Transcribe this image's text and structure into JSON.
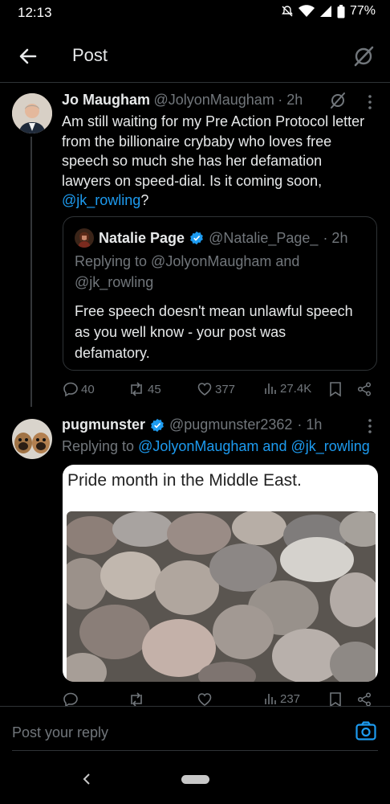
{
  "status_bar": {
    "time": "12:13",
    "battery": "77%"
  },
  "header": {
    "title": "Post"
  },
  "main_tweet": {
    "name": "Jo Maugham",
    "handle": "@JolyonMaugham",
    "time": "· 2h",
    "text_before": "Am still waiting for my Pre Action Protocol letter from the billionaire crybaby who loves free speech so much she has her defamation lawyers on speed-dial. Is it coming soon, ",
    "mention": "@jk_rowling",
    "text_after": "?",
    "quote": {
      "name": "Natalie Page",
      "handle": "@Natalie_Page_",
      "time": "· 2h",
      "reply_to": "Replying to @JolyonMaugham and @jk_rowling",
      "text": "Free speech doesn't mean unlawful speech as you well know - your post was defamatory."
    },
    "stats": {
      "replies": "40",
      "reposts": "45",
      "likes": "377",
      "views": "27.4K"
    }
  },
  "reply_tweet": {
    "name": "pugmunster",
    "handle": "@pugmunster2362",
    "time": "· 1h",
    "replying_prefix": "Replying to",
    "replying_to": "@JolyonMaugham and @jk_rowling",
    "image_caption": "Pride month in the Middle East.",
    "stats": {
      "views": "237"
    }
  },
  "reply_bar": {
    "placeholder": "Post your reply"
  },
  "colors": {
    "accent": "#1d9bf0",
    "muted": "#71767b",
    "background": "#000000"
  }
}
